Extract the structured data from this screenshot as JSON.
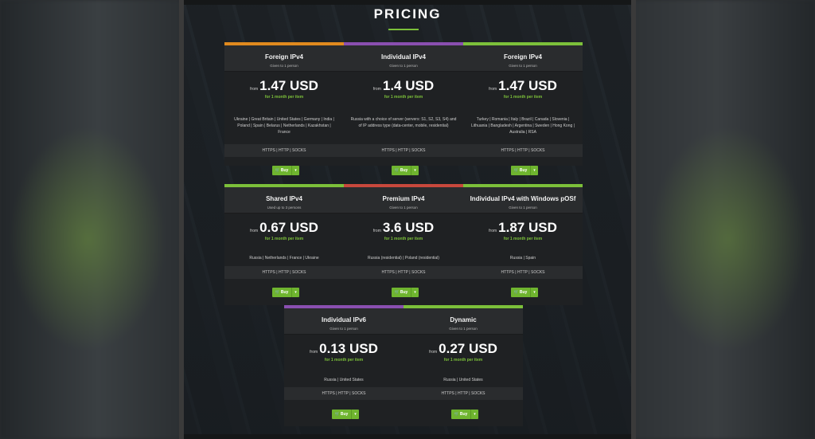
{
  "page": {
    "title": "PRICING"
  },
  "colors": {
    "accent": "#7cc03a",
    "orange": "#e08a1e",
    "purple": "#8a4fb0",
    "green": "#6fb52f",
    "red": "#c8483c"
  },
  "cards": [
    {
      "name": "Foreign IPv4",
      "sub": "Given to 1 person",
      "from": "from",
      "price": "1.47 USD",
      "period": "for 1 month per item",
      "locations": "Ukraine | Great Britain | United States | Germany | India | Poland | Spain | Belarus | Netherlands | Kazakhstan | France",
      "protocols": "HTTPS | HTTP | SOCKS",
      "buy": "Buy",
      "bar": "orange"
    },
    {
      "name": "Individual IPv4",
      "sub": "Given to 1 person",
      "from": "from",
      "price": "1.4 USD",
      "period": "for 1 month per item",
      "locations": "Russia with a choice of server (servers: S1, S2, S3, S4) and of IP address type (data-center, mobile, residential)",
      "protocols": "HTTPS | HTTP | SOCKS",
      "buy": "Buy",
      "bar": "purple"
    },
    {
      "name": "Foreign IPv4",
      "sub": "Given to 1 person",
      "from": "from",
      "price": "1.47 USD",
      "period": "for 1 month per item",
      "locations": "Turkey | Romania | Italy | Brazil | Canada | Slovenia | Lithuania | Bangladesh | Argentina | Sweden | Hong Kong | Australia | RSA",
      "protocols": "HTTPS | HTTP | SOCKS",
      "buy": "Buy",
      "bar": "green"
    },
    {
      "name": "Shared IPv4",
      "sub": "Used up to 3 persons",
      "from": "from",
      "price": "0.67 USD",
      "period": "for 1 month per item",
      "locations": "Russia | Netherlands | France | Ukraine",
      "protocols": "HTTPS | HTTP | SOCKS",
      "buy": "Buy",
      "bar": "green"
    },
    {
      "name": "Premium IPv4",
      "sub": "Given to 1 person",
      "from": "from",
      "price": "3.6 USD",
      "period": "for 1 month per item",
      "locations": "Russia (residential) | Poland (residential)",
      "protocols": "HTTPS | HTTP | SOCKS",
      "buy": "Buy",
      "bar": "red"
    },
    {
      "name": "Individual IPv4 with Windows pOSf",
      "sub": "Given to 1 person",
      "from": "from",
      "price": "1.87 USD",
      "period": "for 1 month per item",
      "locations": "Russia | Spain",
      "protocols": "HTTPS | HTTP | SOCKS",
      "buy": "Buy",
      "bar": "green"
    },
    {
      "name": "Individual IPv6",
      "sub": "Given to 1 person",
      "from": "from",
      "price": "0.13 USD",
      "period": "for 1 month per item",
      "locations": "Russia | United States",
      "protocols": "HTTPS | HTTP | SOCKS",
      "buy": "Buy",
      "bar": "purple"
    },
    {
      "name": "Dynamic",
      "sub": "Given to 1 person",
      "from": "from",
      "price": "0.27 USD",
      "period": "for 1 month per item",
      "locations": "Russia | United States",
      "protocols": "HTTPS | HTTP | SOCKS",
      "buy": "Buy",
      "bar": "green"
    }
  ]
}
